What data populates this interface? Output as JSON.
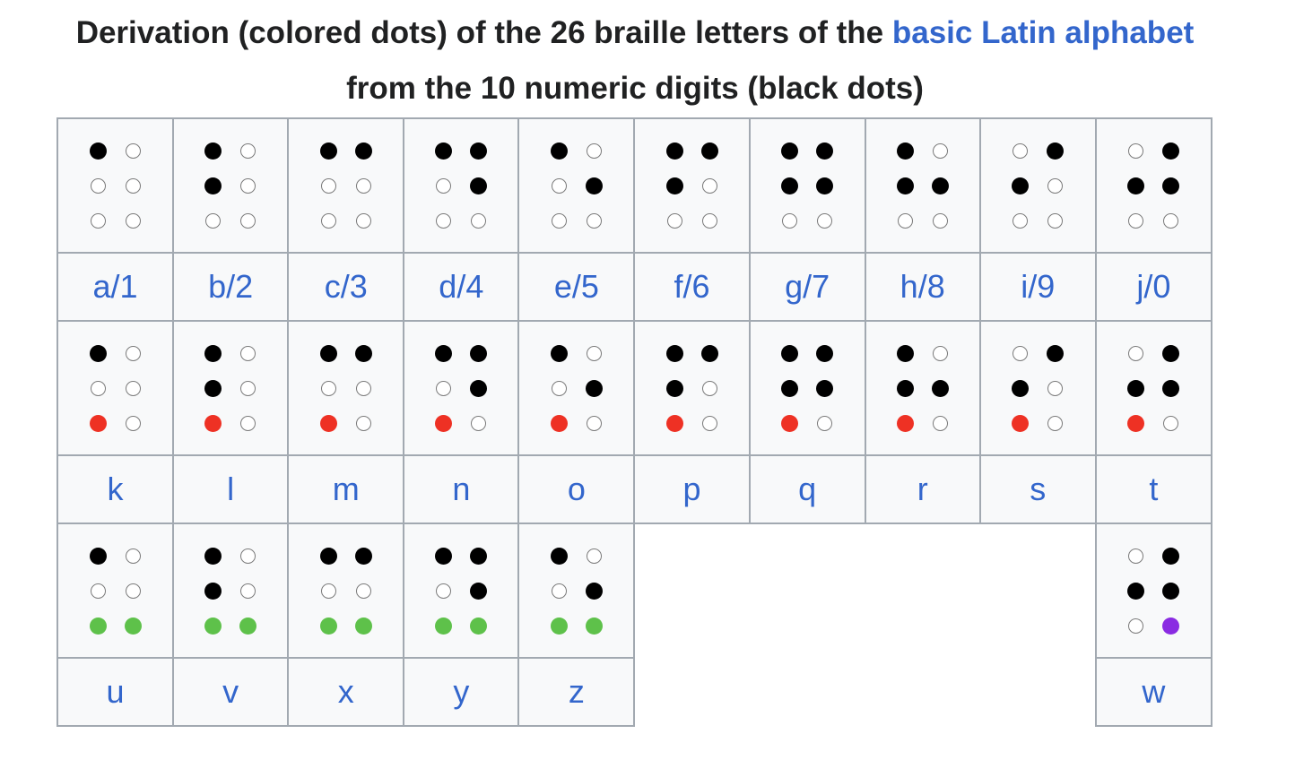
{
  "caption": {
    "text_before": "Derivation (colored dots) of the 26 braille letters of the ",
    "link": "basic Latin alphabet",
    "text_after": " from the 10 numeric digits (black dots)"
  },
  "colors": {
    "black": "#000000",
    "red": "#ee3124",
    "green": "#5ec14a",
    "purple": "#8a2be2",
    "link": "#3366cc"
  },
  "rows": [
    {
      "cells": [
        {
          "label": "a/1",
          "dots": [
            "black",
            "empty",
            "empty",
            "empty",
            "empty",
            "empty"
          ]
        },
        {
          "label": "b/2",
          "dots": [
            "black",
            "empty",
            "black",
            "empty",
            "empty",
            "empty"
          ]
        },
        {
          "label": "c/3",
          "dots": [
            "black",
            "black",
            "empty",
            "empty",
            "empty",
            "empty"
          ]
        },
        {
          "label": "d/4",
          "dots": [
            "black",
            "black",
            "empty",
            "black",
            "empty",
            "empty"
          ]
        },
        {
          "label": "e/5",
          "dots": [
            "black",
            "empty",
            "empty",
            "black",
            "empty",
            "empty"
          ]
        },
        {
          "label": "f/6",
          "dots": [
            "black",
            "black",
            "black",
            "empty",
            "empty",
            "empty"
          ]
        },
        {
          "label": "g/7",
          "dots": [
            "black",
            "black",
            "black",
            "black",
            "empty",
            "empty"
          ]
        },
        {
          "label": "h/8",
          "dots": [
            "black",
            "empty",
            "black",
            "black",
            "empty",
            "empty"
          ]
        },
        {
          "label": "i/9",
          "dots": [
            "empty",
            "black",
            "black",
            "empty",
            "empty",
            "empty"
          ]
        },
        {
          "label": "j/0",
          "dots": [
            "empty",
            "black",
            "black",
            "black",
            "empty",
            "empty"
          ]
        }
      ]
    },
    {
      "cells": [
        {
          "label": "k",
          "dots": [
            "black",
            "empty",
            "empty",
            "empty",
            "red",
            "empty"
          ]
        },
        {
          "label": "l",
          "dots": [
            "black",
            "empty",
            "black",
            "empty",
            "red",
            "empty"
          ]
        },
        {
          "label": "m",
          "dots": [
            "black",
            "black",
            "empty",
            "empty",
            "red",
            "empty"
          ]
        },
        {
          "label": "n",
          "dots": [
            "black",
            "black",
            "empty",
            "black",
            "red",
            "empty"
          ]
        },
        {
          "label": "o",
          "dots": [
            "black",
            "empty",
            "empty",
            "black",
            "red",
            "empty"
          ]
        },
        {
          "label": "p",
          "dots": [
            "black",
            "black",
            "black",
            "empty",
            "red",
            "empty"
          ]
        },
        {
          "label": "q",
          "dots": [
            "black",
            "black",
            "black",
            "black",
            "red",
            "empty"
          ]
        },
        {
          "label": "r",
          "dots": [
            "black",
            "empty",
            "black",
            "black",
            "red",
            "empty"
          ]
        },
        {
          "label": "s",
          "dots": [
            "empty",
            "black",
            "black",
            "empty",
            "red",
            "empty"
          ]
        },
        {
          "label": "t",
          "dots": [
            "empty",
            "black",
            "black",
            "black",
            "red",
            "empty"
          ]
        }
      ]
    },
    {
      "cells": [
        {
          "label": "u",
          "dots": [
            "black",
            "empty",
            "empty",
            "empty",
            "green",
            "green"
          ]
        },
        {
          "label": "v",
          "dots": [
            "black",
            "empty",
            "black",
            "empty",
            "green",
            "green"
          ]
        },
        {
          "label": "x",
          "dots": [
            "black",
            "black",
            "empty",
            "empty",
            "green",
            "green"
          ]
        },
        {
          "label": "y",
          "dots": [
            "black",
            "black",
            "empty",
            "black",
            "green",
            "green"
          ]
        },
        {
          "label": "z",
          "dots": [
            "black",
            "empty",
            "empty",
            "black",
            "green",
            "green"
          ]
        },
        null,
        null,
        null,
        null,
        {
          "label": "w",
          "dots": [
            "empty",
            "black",
            "black",
            "black",
            "empty",
            "purple"
          ]
        }
      ]
    }
  ]
}
